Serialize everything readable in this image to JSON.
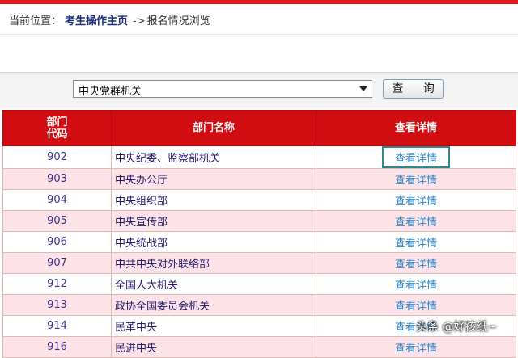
{
  "breadcrumb": {
    "prefix": "当前位置：",
    "home": "考生操作主页",
    "arrow": "->",
    "current": "报名情况浏览"
  },
  "search": {
    "selected": "中央党群机关",
    "button": "查 询"
  },
  "table": {
    "headers": {
      "code_line1": "部门",
      "code_line2": "代码",
      "name": "部门名称",
      "detail": "查看详情"
    },
    "rows": [
      {
        "code": "902",
        "name": "中央纪委、监察部机关",
        "link": "查看详情"
      },
      {
        "code": "903",
        "name": "中央办公厅",
        "link": "查看详情"
      },
      {
        "code": "904",
        "name": "中央组织部",
        "link": "查看详情"
      },
      {
        "code": "905",
        "name": "中央宣传部",
        "link": "查看详情"
      },
      {
        "code": "906",
        "name": "中央统战部",
        "link": "查看详情"
      },
      {
        "code": "907",
        "name": "中共中央对外联络部",
        "link": "查看详情"
      },
      {
        "code": "912",
        "name": "全国人大机关",
        "link": "查看详情"
      },
      {
        "code": "913",
        "name": "政协全国委员会机关",
        "link": "查看详情"
      },
      {
        "code": "914",
        "name": "民革中央",
        "link": "查看详情"
      },
      {
        "code": "916",
        "name": "民进中央",
        "link": "查看详情"
      }
    ]
  },
  "watermark": "头条 @好孩纸~",
  "colors": {
    "header_red": "#d20d12",
    "row_pink": "#fde3e7",
    "link_blue": "#2e87c8",
    "focus_teal": "#2a8a8a"
  }
}
